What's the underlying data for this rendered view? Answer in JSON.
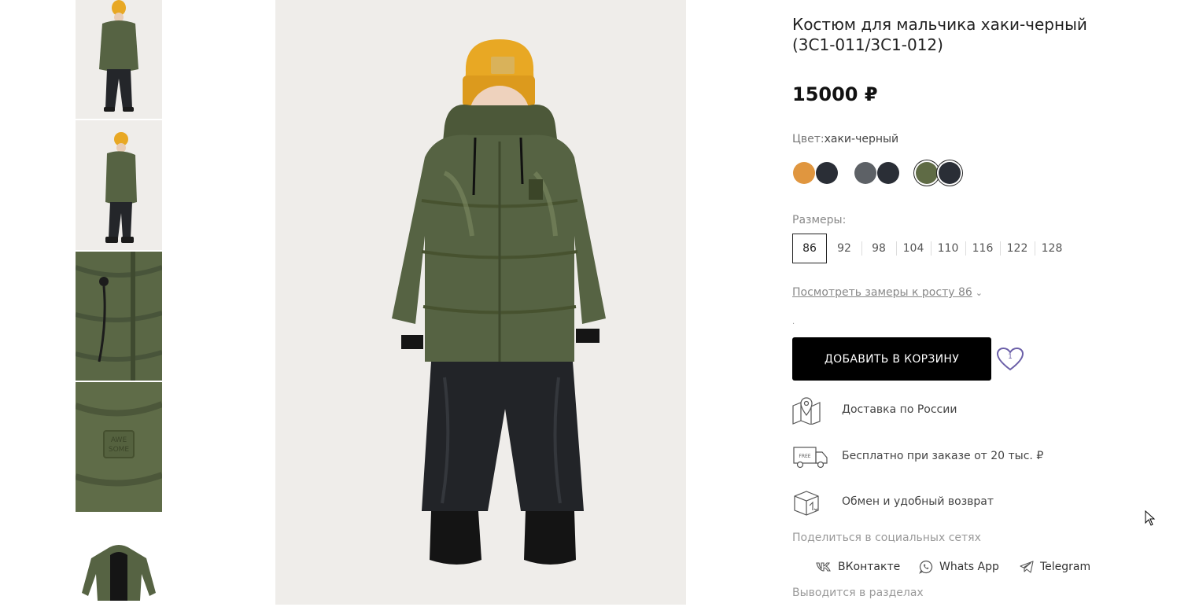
{
  "product": {
    "title": "Костюм для мальчика хаки-черный (3С1-011/3С1-012)",
    "price": "15000 ₽",
    "color_label": "Цвет:",
    "color_value": "хаки-черный",
    "swatches": [
      {
        "name": "orange-black",
        "colors": [
          "#e0963f",
          "#2a2e36"
        ],
        "active": false
      },
      {
        "name": "grey-black",
        "colors": [
          "#5d6166",
          "#2a2e36"
        ],
        "active": false
      },
      {
        "name": "khaki-black",
        "colors": [
          "#5f6b45",
          "#2a2e36"
        ],
        "active": true
      }
    ],
    "sizes_label": "Размеры:",
    "sizes": [
      "86",
      "92",
      "98",
      "104",
      "110",
      "116",
      "122",
      "128"
    ],
    "selected_size": "86",
    "measure_link": "Посмотреть замеры к росту 86",
    "dot_text": ".",
    "add_to_cart": "ДОБАВИТЬ В КОРЗИНУ",
    "favorite_count": "1"
  },
  "benefits": [
    {
      "icon": "map-pin-icon",
      "text": "Доставка по России"
    },
    {
      "icon": "free-delivery-truck-icon",
      "text": "Бесплатно при заказе от 20 тыс. ₽"
    },
    {
      "icon": "return-box-icon",
      "text": "Обмен и удобный возврат"
    }
  ],
  "share": {
    "label": "Поделиться в социальных сетях",
    "items": [
      {
        "icon": "vk-icon",
        "label": "ВКонтакте"
      },
      {
        "icon": "whatsapp-icon",
        "label": "Whats App"
      },
      {
        "icon": "telegram-icon",
        "label": "Telegram"
      }
    ]
  },
  "sections_label": "Выводится в разделах",
  "colors": {
    "accent": "#000000",
    "favorite": "#6b5fa8",
    "jacket": "#566343",
    "hat": "#e8a824"
  }
}
